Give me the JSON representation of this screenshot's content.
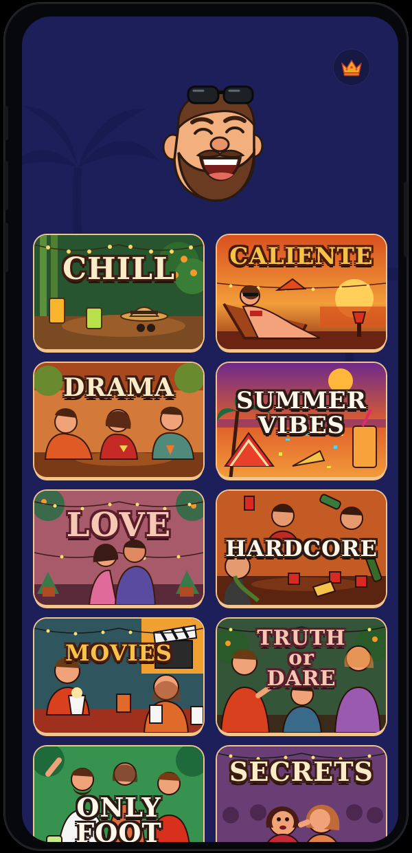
{
  "header": {
    "premium_icon": "crown-icon",
    "mascot": "bearded-man-mascot"
  },
  "colors": {
    "background": "#1c1f5a",
    "card_border": "#f2c48e",
    "crown": "#f39c12"
  },
  "categories": [
    {
      "id": "chill",
      "label": "CHILL"
    },
    {
      "id": "caliente",
      "label": "CALIENTE"
    },
    {
      "id": "drama",
      "label": "DRAMA"
    },
    {
      "id": "summer-vibes",
      "label": "SUMMER\nVIBES"
    },
    {
      "id": "love",
      "label": "LOVE"
    },
    {
      "id": "hardcore",
      "label": "HARDCORE"
    },
    {
      "id": "movies",
      "label": "MOVIES"
    },
    {
      "id": "truth-or-dare",
      "label": "TRUTH\nor\nDARE"
    },
    {
      "id": "only-foot",
      "label": "ONLY\nFOOT"
    },
    {
      "id": "secrets",
      "label": "SECRETS"
    }
  ]
}
